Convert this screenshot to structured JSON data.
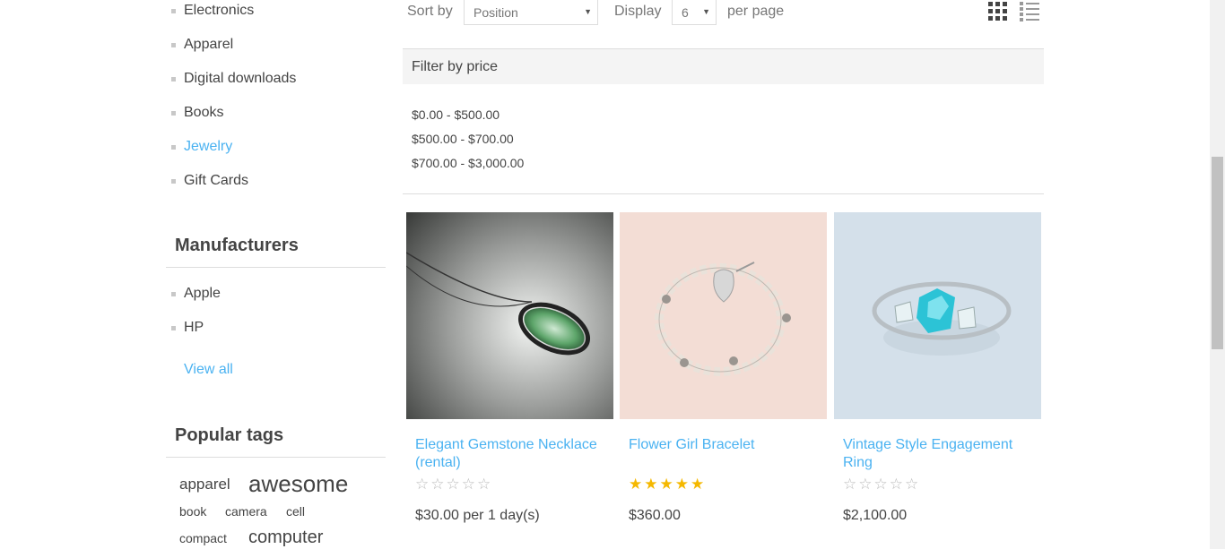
{
  "categories": [
    {
      "label": "Electronics",
      "active": false
    },
    {
      "label": "Apparel",
      "active": false
    },
    {
      "label": "Digital downloads",
      "active": false
    },
    {
      "label": "Books",
      "active": false
    },
    {
      "label": "Jewelry",
      "active": true
    },
    {
      "label": "Gift Cards",
      "active": false
    }
  ],
  "manufacturers": {
    "title": "Manufacturers",
    "items": [
      "Apple",
      "HP"
    ],
    "view_all": "View all"
  },
  "popular_tags": {
    "title": "Popular tags",
    "tags": [
      "apparel",
      "awesome",
      "book",
      "camera",
      "cell",
      "compact",
      "computer"
    ]
  },
  "toolbar": {
    "sort_label": "Sort by",
    "sort_value": "Position",
    "display_label": "Display",
    "display_value": "6",
    "per_page_label": "per page"
  },
  "filter": {
    "title": "Filter by price",
    "ranges": [
      "$0.00 - $500.00",
      "$500.00 - $700.00",
      "$700.00 - $3,000.00"
    ]
  },
  "products": [
    {
      "title": "Elegant Gemstone Necklace (rental)",
      "rating_stars": 0,
      "price": "$30.00 per 1 day(s)"
    },
    {
      "title": "Flower Girl Bracelet",
      "rating_stars": 5,
      "price": "$360.00"
    },
    {
      "title": "Vintage Style Engagement Ring",
      "rating_stars": 0,
      "price": "$2,100.00"
    }
  ],
  "colors": {
    "accent": "#4ab2f1",
    "star": "#f5b800"
  }
}
